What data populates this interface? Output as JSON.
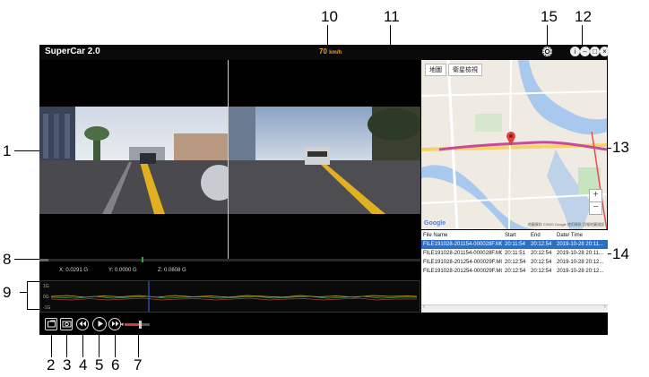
{
  "app": {
    "title": "SuperCar 2.0",
    "speed": "70",
    "speed_unit": "km/h"
  },
  "window_buttons": {
    "info": "i",
    "minimize": "–",
    "maximize": "□",
    "close": "×"
  },
  "map": {
    "tabs": [
      "地圖",
      "衛星檢視"
    ],
    "logo": "Google",
    "credit": "地圖資料 ©2020 Google 使用條款 回報地圖錯誤",
    "zoom_in": "+",
    "zoom_out": "−"
  },
  "filelist": {
    "columns": [
      "File Name",
      "Start",
      "End",
      "Date/ Time"
    ],
    "rows": [
      {
        "name": "FILE191028-201154-000028F.MOV",
        "start": "20:11:54",
        "end": "20:12:54",
        "date": "2019-10-28 20:11..."
      },
      {
        "name": "FILE191028-201154-000028F.MOV",
        "start": "20:11:51",
        "end": "20:12:54",
        "date": "2019-10-28 20:11..."
      },
      {
        "name": "FILE191028-201254-000029F.MOV",
        "start": "20:12:54",
        "end": "20:12:54",
        "date": "2019-10-28 20:12..."
      },
      {
        "name": "FILE191028-201254-000029F.MOV",
        "start": "20:12:54",
        "end": "20:12:54",
        "date": "2019-10-28 20:12..."
      }
    ],
    "selected_index": 0
  },
  "gsensor": {
    "x": "X: 0.0291 G",
    "y": "Y: 0.0000 G",
    "z": "Z: 0.0608 G",
    "graph_labels": [
      "1G",
      "0G",
      "-1G"
    ]
  },
  "volume": {
    "level": 0.6
  },
  "playback": {
    "progress": 0.27
  },
  "callouts": [
    "1",
    "2",
    "3",
    "4",
    "5",
    "6",
    "7",
    "8",
    "9",
    "10",
    "11",
    "12",
    "13",
    "14",
    "15"
  ],
  "colors": {
    "speed": "#f0a020",
    "selection": "#2d6fc4",
    "route": "#c84a9a"
  }
}
